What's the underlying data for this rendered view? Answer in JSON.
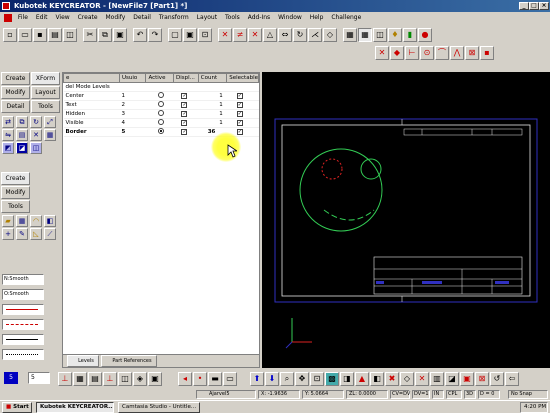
{
  "window": {
    "title": "Kubotek KEYCREATOR - [NewFile7 [Part1] *]",
    "min": "_",
    "max": "□",
    "close": "×"
  },
  "menu": [
    "File",
    "Edit",
    "View",
    "Create",
    "Modify",
    "Detail",
    "Transform",
    "Layout",
    "Tools",
    "Add-Ins",
    "Window",
    "Help",
    "Challenge"
  ],
  "left_tabs": {
    "create": "Create",
    "xform": "XForm",
    "modify": "Modify",
    "layout": "Layout",
    "detail": "Detail",
    "tools": "Tools"
  },
  "left_tabs2": {
    "create": "Create",
    "modify": "Modify",
    "tools": "Tools"
  },
  "style_lists": {
    "line1": "N:Smooth",
    "line2": "O:Smooth"
  },
  "table": {
    "headers": [
      "e",
      "Usuio",
      "Active",
      "Displ...",
      "Count",
      "Selectable"
    ],
    "group": "del Mode Levels",
    "rows": [
      {
        "name": "Center",
        "num": "1",
        "active": false,
        "disp": true,
        "count": "1",
        "sel": true,
        "bold": false
      },
      {
        "name": "Text",
        "num": "2",
        "active": false,
        "disp": true,
        "count": "1",
        "sel": true,
        "bold": false
      },
      {
        "name": "Hidden",
        "num": "3",
        "active": false,
        "disp": true,
        "count": "1",
        "sel": true,
        "bold": false
      },
      {
        "name": "Visible",
        "num": "4",
        "active": false,
        "disp": true,
        "count": "1",
        "sel": true,
        "bold": false
      },
      {
        "name": "Border",
        "num": "5",
        "active": true,
        "disp": true,
        "count": "36",
        "sel": true,
        "bold": true
      }
    ],
    "tab1": "Levels",
    "tab2": "Part References"
  },
  "bottom": {
    "level": "5",
    "style": "5"
  },
  "status": {
    "s1": "Ajarvel5",
    "s2": "X: -1.9636",
    "s3": "Y: 5.0664",
    "s4": "ZL: 0.0000",
    "s5": "CV=DV",
    "s6": "DV=1",
    "s7": "IN",
    "s8": "CPL",
    "s9": "3D",
    "s10": "D = 0",
    "s11": "No Snap"
  },
  "taskbar": {
    "start": "Start",
    "task1": "Kubotek KEYCREATOR...",
    "task2": "Camtasia Studio - Untitle...",
    "clock": "4:20 PM"
  },
  "colors": {
    "drawing_white": "#e8e8e8",
    "drawing_green": "#33cc55",
    "drawing_red": "#dd2222",
    "border_blue": "#3030c0"
  }
}
